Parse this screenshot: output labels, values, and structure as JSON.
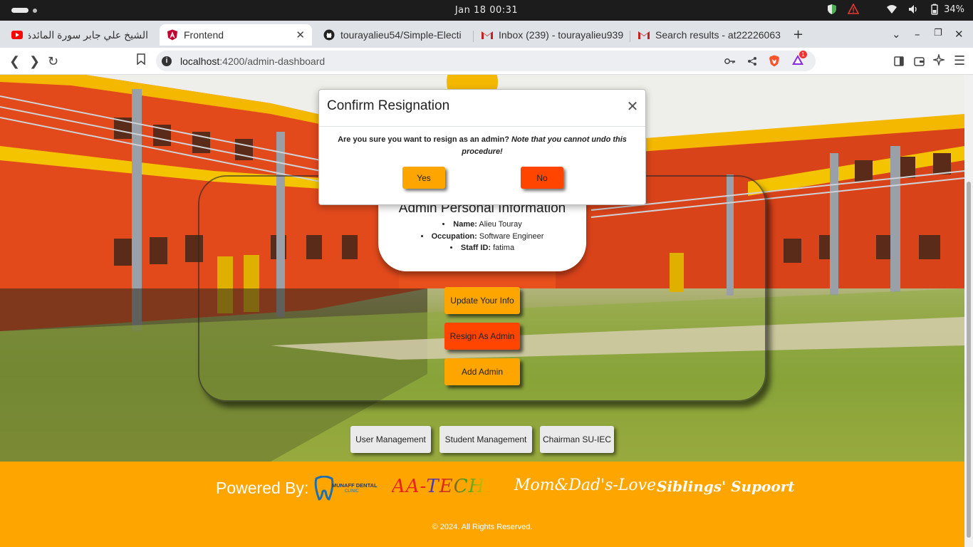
{
  "system": {
    "clock": "Jan 18  00:31",
    "battery": "34%"
  },
  "browser": {
    "tabs": [
      {
        "label": "الشيخ علي جابر سورة المائدة - e"
      },
      {
        "label": "Frontend"
      },
      {
        "label": "tourayalieu54/Simple-Electi"
      },
      {
        "label": "Inbox (239) - tourayalieu939"
      },
      {
        "label": "Search results - at22226063"
      }
    ],
    "new_tab_label": "+",
    "url_host": "localhost",
    "url_path": ":4200/admin-dashboard",
    "brave_badge": "1"
  },
  "admin_card": {
    "title": "Admin Personal Information",
    "name_label": "Name:",
    "name_value": "Alieu Touray",
    "occupation_label": "Occupation:",
    "occupation_value": "Software Engineer",
    "staff_label": "Staff ID:",
    "staff_value": "fatima"
  },
  "actions": {
    "update": "Update Your Info",
    "resign": "Resign As Admin",
    "add": "Add Admin"
  },
  "nav": {
    "users": "User Management",
    "students": "Student Management",
    "chairman": "Chairman SU-IEC"
  },
  "footer": {
    "powered_by": "Powered By:",
    "logo_munaff": "MUNAFF DENTAL",
    "logo_munaff_sub": "CLINIC",
    "logo_aatech": "AA-TECH",
    "logo_mom": "Mom&Dad's-Love",
    "logo_sib": "Siblings' Supoort",
    "copyright": "© 2024. All Rights Reserved."
  },
  "modal": {
    "title": "Confirm Resignation",
    "question": "Are you sure you want to resign as an admin?",
    "note": "Note that you cannot undo this procedure!",
    "yes": "Yes",
    "no": "No"
  },
  "colors": {
    "orange": "#ffa500",
    "red": "#ff4500"
  }
}
